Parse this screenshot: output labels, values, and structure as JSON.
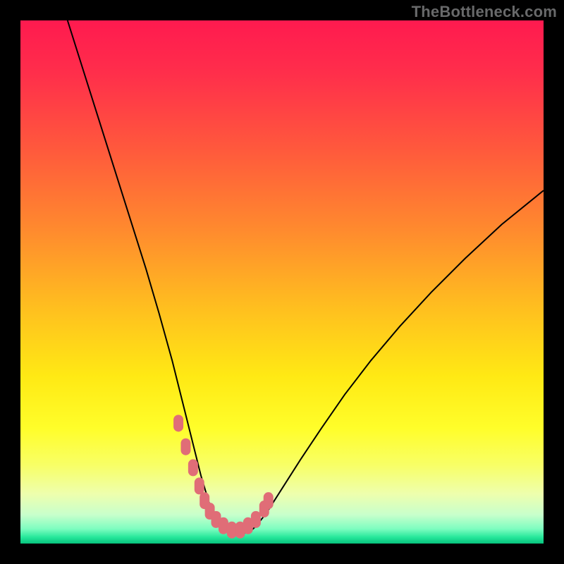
{
  "attribution": "TheBottleneck.com",
  "colors": {
    "page_bg": "#000000",
    "curve": "#000000",
    "marker_fill": "#e06d77",
    "gradient_stops": [
      {
        "offset": 0.0,
        "color": "#ff1a4f"
      },
      {
        "offset": 0.1,
        "color": "#ff2e4b"
      },
      {
        "offset": 0.25,
        "color": "#ff5a3c"
      },
      {
        "offset": 0.4,
        "color": "#ff8a2e"
      },
      {
        "offset": 0.55,
        "color": "#ffbf1f"
      },
      {
        "offset": 0.68,
        "color": "#ffe914"
      },
      {
        "offset": 0.78,
        "color": "#fffe2a"
      },
      {
        "offset": 0.85,
        "color": "#f8ff66"
      },
      {
        "offset": 0.905,
        "color": "#eeffad"
      },
      {
        "offset": 0.945,
        "color": "#c8ffcc"
      },
      {
        "offset": 0.972,
        "color": "#7dfdc0"
      },
      {
        "offset": 0.988,
        "color": "#25e79a"
      },
      {
        "offset": 1.0,
        "color": "#07c27d"
      }
    ]
  },
  "chart_data": {
    "type": "line",
    "title": "",
    "xlabel": "",
    "ylabel": "",
    "xlim": [
      0,
      100
    ],
    "ylim": [
      0,
      100
    ],
    "grid": false,
    "legend": false,
    "series": [
      {
        "name": "left-branch",
        "x": [
          9,
          12,
          15,
          18,
          21,
          24,
          26.5,
          29,
          31,
          33,
          34.5,
          36,
          37,
          37.8
        ],
        "y": [
          100,
          90.5,
          81,
          71.5,
          62,
          52.5,
          44,
          35,
          27,
          19,
          13,
          8,
          5,
          3.3
        ]
      },
      {
        "name": "valley-floor",
        "x": [
          37.8,
          39,
          40.2,
          41.5,
          42.8,
          44,
          45
        ],
        "y": [
          3.3,
          2.4,
          2.0,
          1.9,
          2.0,
          2.4,
          3.3
        ]
      },
      {
        "name": "right-branch",
        "x": [
          45,
          47,
          50,
          53.5,
          57.5,
          62,
          67,
          72.5,
          78.5,
          85,
          92,
          100
        ],
        "y": [
          3.3,
          5.8,
          10.5,
          16,
          22,
          28.5,
          35,
          41.5,
          48,
          54.5,
          61,
          67.5
        ]
      }
    ],
    "markers": {
      "name": "highlighted-points",
      "x": [
        30.2,
        31.6,
        33.0,
        34.2,
        35.2,
        36.2,
        37.4,
        38.8,
        40.4,
        42.0,
        43.5,
        45.0,
        46.6,
        47.4
      ],
      "y": [
        23.0,
        18.5,
        14.5,
        11.0,
        8.2,
        6.2,
        4.6,
        3.4,
        2.6,
        2.6,
        3.4,
        4.6,
        6.6,
        8.2
      ]
    }
  }
}
